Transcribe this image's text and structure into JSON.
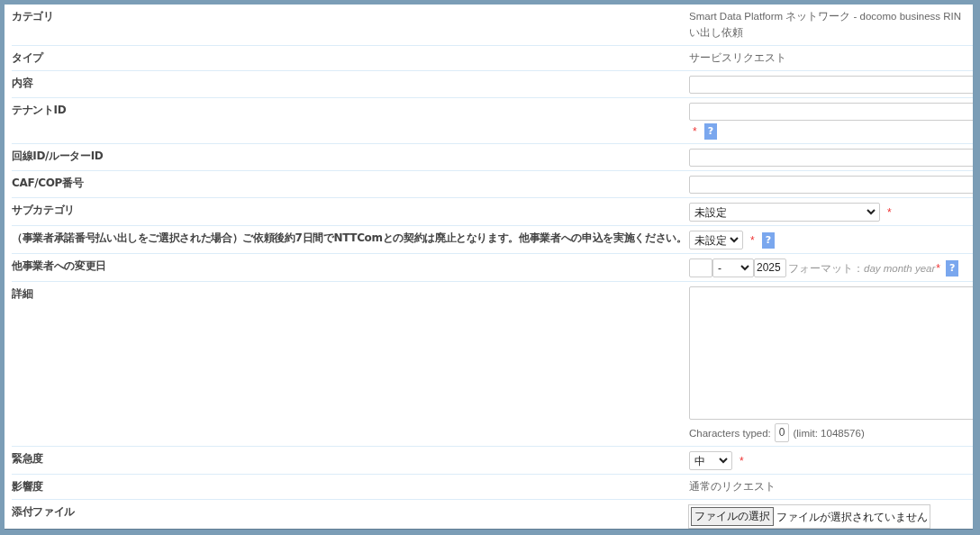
{
  "rows": [
    {
      "label": "カテゴリ",
      "kind": "text",
      "value_lines": [
        "Smart Data Platform ネットワーク - docomo business RIN",
        "い出し依頼"
      ]
    },
    {
      "label": "タイプ",
      "kind": "text",
      "value_lines": [
        "サービスリクエスト"
      ]
    },
    {
      "label": "内容",
      "kind": "input"
    },
    {
      "label": "テナントID",
      "kind": "input_note",
      "required_mark": "*",
      "help": "?"
    },
    {
      "label": "回線ID/ルーターID",
      "kind": "input"
    },
    {
      "label": "CAF/COP番号",
      "kind": "input"
    },
    {
      "label": "サブカテゴリ",
      "kind": "wide_select",
      "value": "未設定",
      "required_mark": "*"
    },
    {
      "label": "（事業者承諾番号払い出しをご選択された場合）ご依頼後約7日間でNTTComとの契約は廃止となります。他事業者への申込を実施ください。",
      "kind": "select",
      "value": "未設定",
      "required_mark": "*",
      "help": "?"
    },
    {
      "label": "他事業者への変更日",
      "kind": "date",
      "month": "-",
      "year": "2025",
      "format": "フォーマット：*day month year*",
      "required_mark": "*",
      "help": "?"
    },
    {
      "label": "詳細",
      "kind": "textarea",
      "counter_label": "Characters typed:",
      "count": "0",
      "limit": "(limit: 1048576)"
    },
    {
      "label": "緊急度",
      "kind": "select",
      "value": "中",
      "required_mark": "*"
    },
    {
      "label": "影響度",
      "kind": "text",
      "value_lines": [
        "通常のリクエスト"
      ]
    },
    {
      "label": "添付ファイル",
      "kind": "file",
      "button": "ファイルの選択",
      "status": "ファイルが選択されていません"
    }
  ]
}
